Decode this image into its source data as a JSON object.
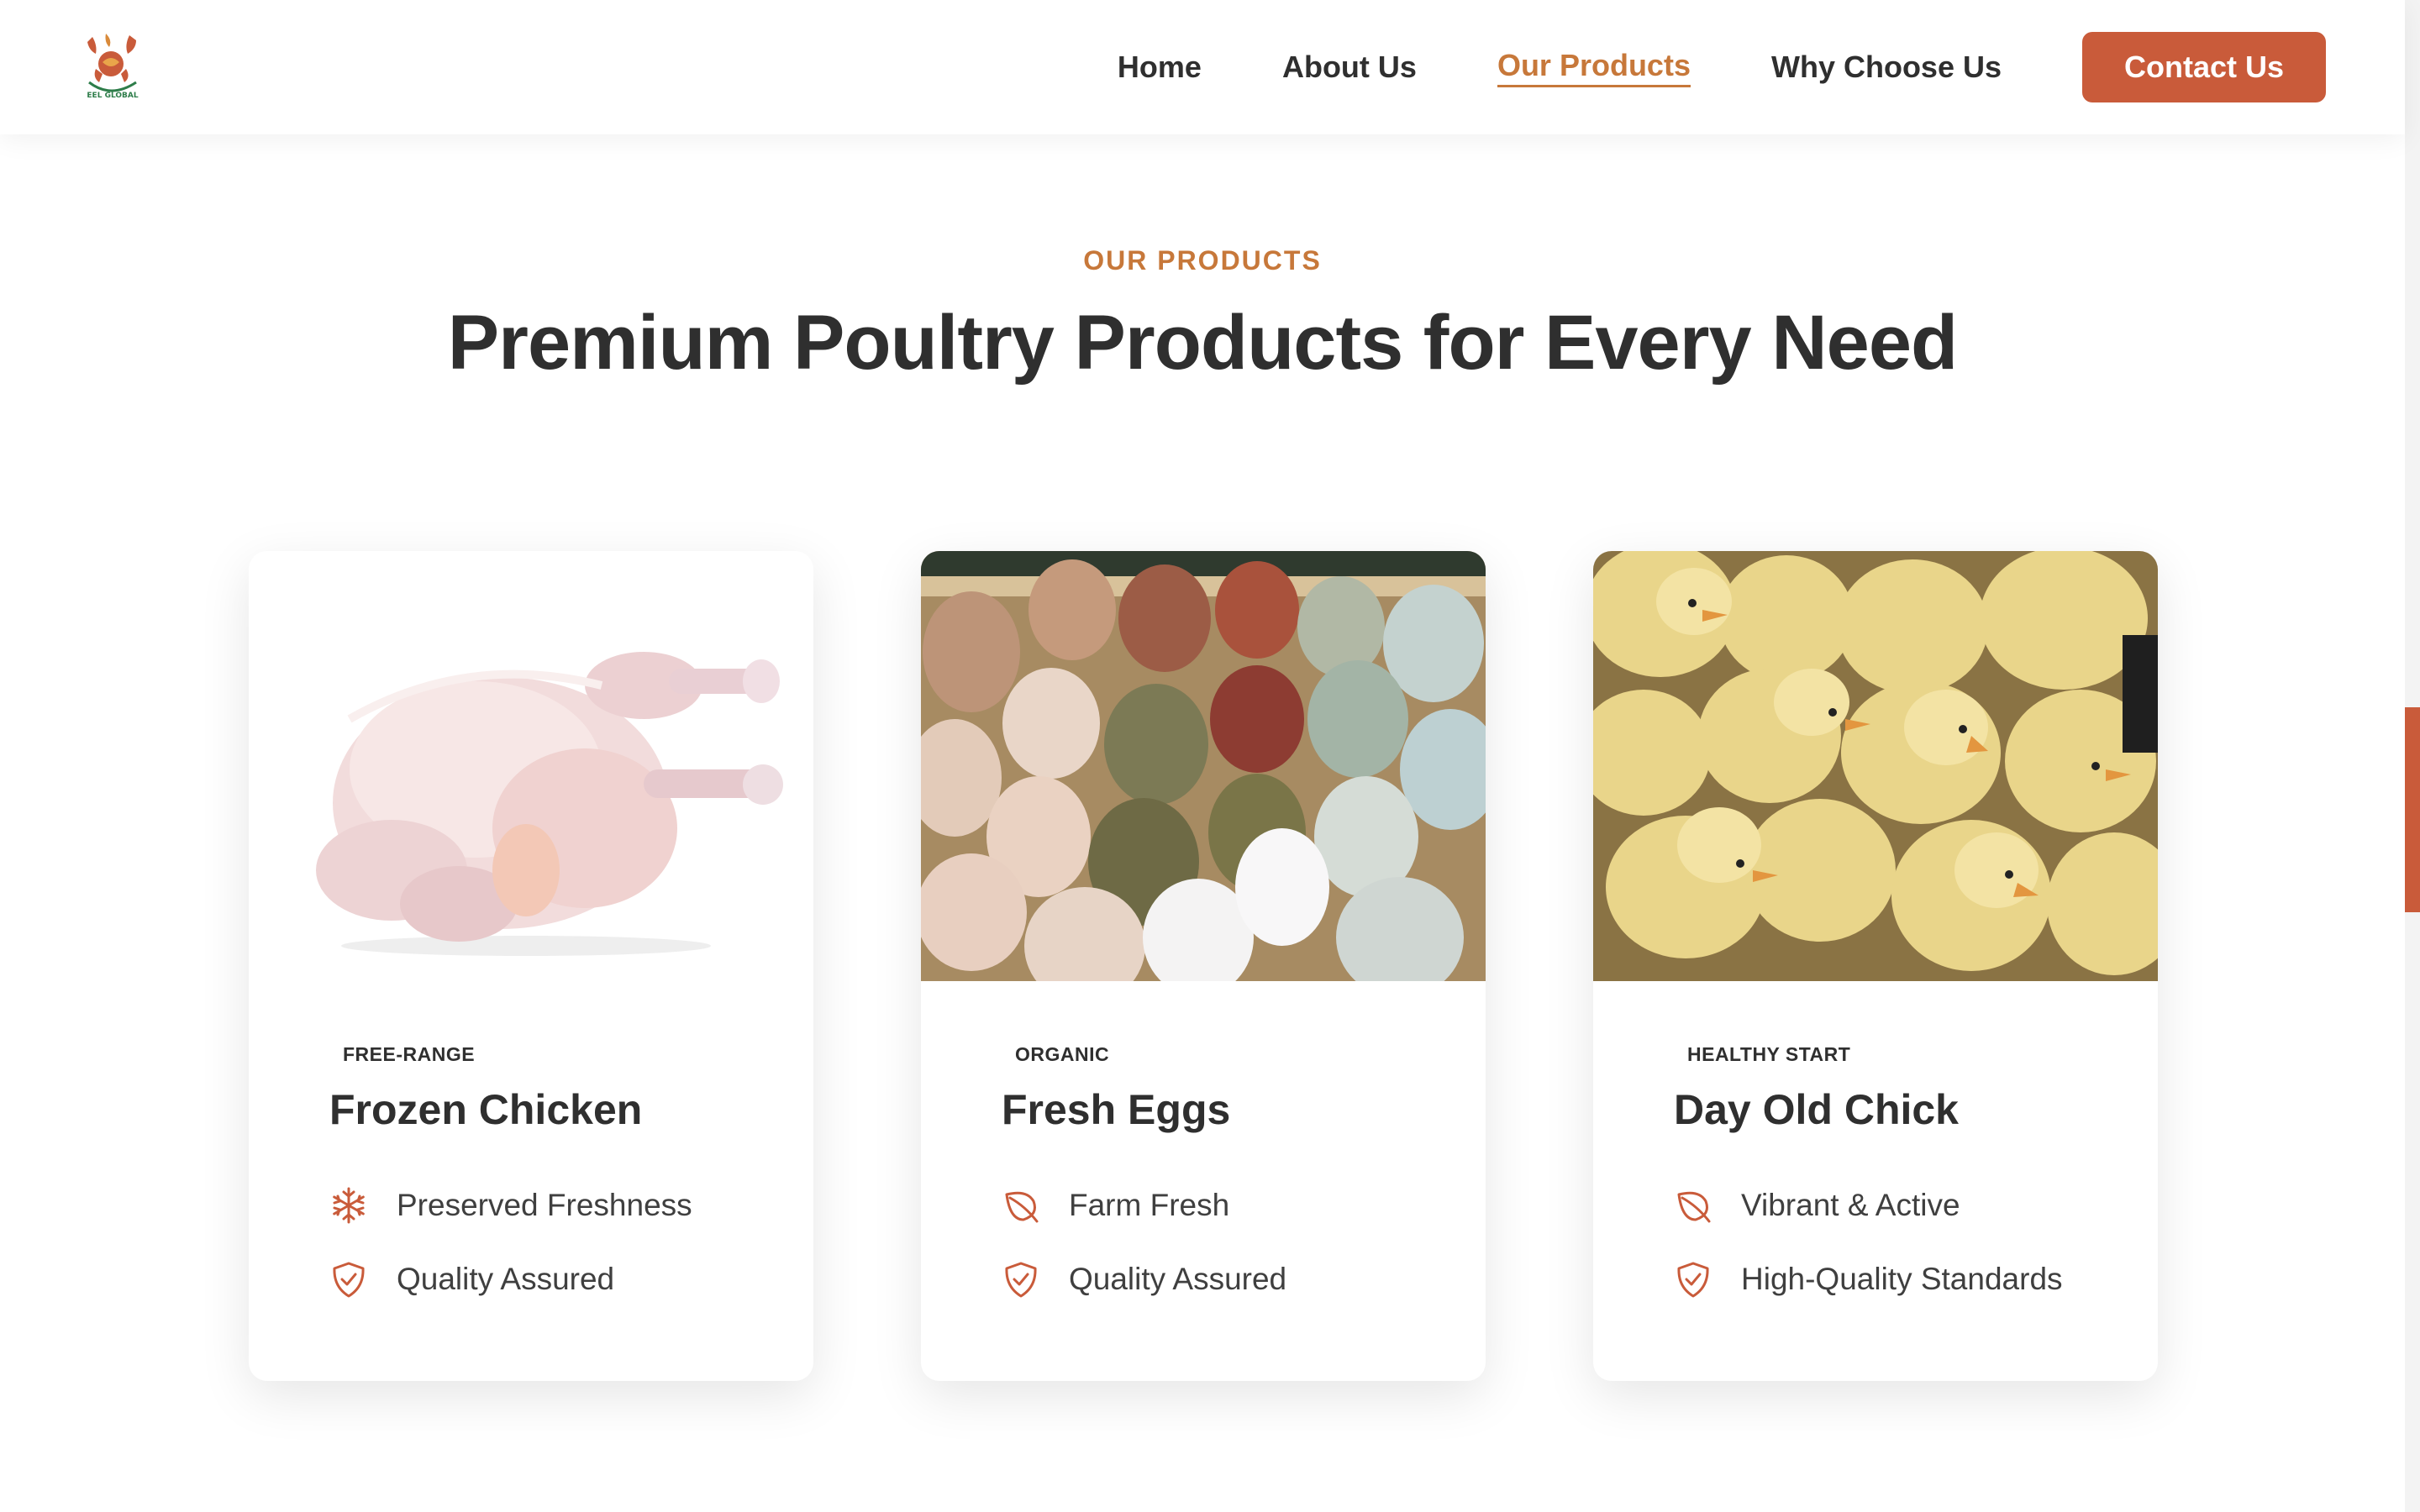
{
  "header": {
    "logo_text": "EEL GLOBAL",
    "nav": {
      "home": "Home",
      "about": "About Us",
      "products": "Our Products",
      "why": "Why Choose Us"
    },
    "contact_label": "Contact Us",
    "active_nav": "Our Products"
  },
  "section": {
    "eyebrow": "OUR PRODUCTS",
    "title": "Premium Poultry Products for Every Need"
  },
  "cards": [
    {
      "tag": "FREE-RANGE",
      "title": "Frozen Chicken",
      "image": "whole-frozen-chicken-photo",
      "features": [
        {
          "icon": "snowflake-icon",
          "text": "Preserved Freshness"
        },
        {
          "icon": "shield-check-icon",
          "text": "Quality Assured"
        }
      ]
    },
    {
      "tag": "ORGANIC",
      "title": "Fresh Eggs",
      "image": "assorted-eggs-in-crate-photo",
      "features": [
        {
          "icon": "leaf-icon",
          "text": "Farm Fresh"
        },
        {
          "icon": "shield-check-icon",
          "text": "Quality Assured"
        }
      ]
    },
    {
      "tag": "HEALTHY START",
      "title": "Day Old Chick",
      "image": "yellow-chicks-photo",
      "features": [
        {
          "icon": "leaf-icon",
          "text": "Vibrant & Active"
        },
        {
          "icon": "shield-check-icon",
          "text": "High-Quality Standards"
        }
      ]
    }
  ],
  "colors": {
    "accent": "#c95b3a",
    "eyebrow": "#c7783a",
    "text": "#2f2f2f"
  }
}
